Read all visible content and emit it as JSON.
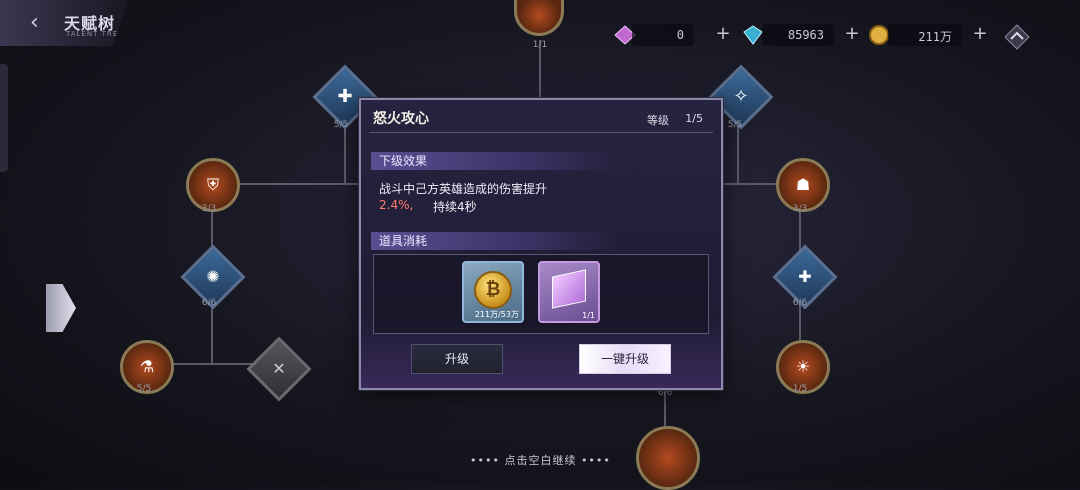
{
  "header": {
    "title": "天赋树",
    "subtitle": "TALENT TREE"
  },
  "resources": [
    {
      "icon": "pink-gem-icon",
      "value": "0"
    },
    {
      "icon": "blue-crystal-icon",
      "value": "85963"
    },
    {
      "icon": "gold-coin-icon",
      "value": "211万"
    }
  ],
  "nodes": [
    {
      "label": "1/1"
    },
    {
      "label": "5/5"
    },
    {
      "label": "5/5"
    },
    {
      "label": "3/3"
    },
    {
      "label": "3/3"
    },
    {
      "label": "6/6"
    },
    {
      "label": "6/6"
    },
    {
      "label": "5/5"
    },
    {
      "label": "1/5"
    },
    {
      "label": "6/6"
    }
  ],
  "modal": {
    "title": "怒火攻心",
    "level_label": "等级",
    "level": "1/5",
    "next_effect_header": "下级效果",
    "effect_text": "战斗中己方英雄造成的伤害提升",
    "effect_percent": "2.4%,",
    "effect_duration": "持续4秒",
    "cost_header": "道具消耗",
    "items": [
      {
        "icon": "gold-coin-item-icon",
        "qty": "211万/53万"
      },
      {
        "icon": "skill-book-item-icon",
        "qty": "1/1"
      }
    ],
    "upgrade_button": "升级",
    "one_click_button": "一键升级"
  },
  "continue_hint": "•••• 点击空白继续 ••••"
}
